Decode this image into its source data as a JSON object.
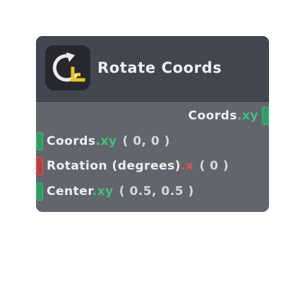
{
  "node": {
    "title": "Rotate Coords",
    "icon": "rotate-coords-icon",
    "colors": {
      "header_bg": "#43464f",
      "body_bg": "#62656c",
      "vector_socket": "#2e9e63",
      "scalar_socket": "#b9403c"
    },
    "outputs": [
      {
        "name": "Coords",
        "suffix": ".xy"
      }
    ],
    "inputs": [
      {
        "name": "Coords",
        "suffix": ".xy",
        "default": "( 0, 0 )"
      },
      {
        "name": "Rotation (degrees)",
        "suffix": ".x",
        "default": "( 0 )"
      },
      {
        "name": "Center",
        "suffix": ".xy",
        "default": "( 0.5, 0.5 )"
      }
    ]
  }
}
